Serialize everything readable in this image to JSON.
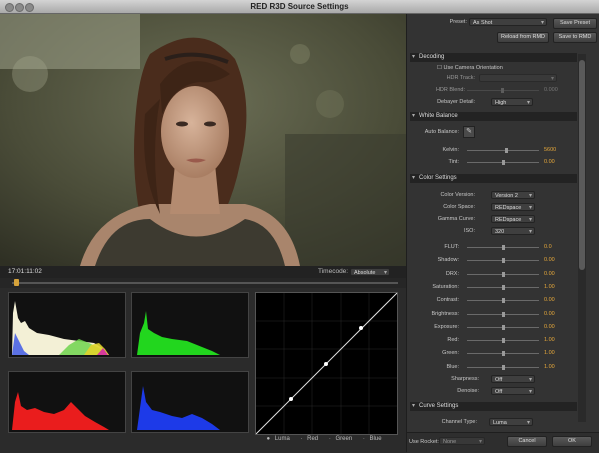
{
  "window": {
    "title": "RED R3D Source Settings"
  },
  "viewer": {
    "timecode": "17:01:11:02",
    "timecode_mode_label": "Timecode:",
    "timecode_mode_value": "Absolute"
  },
  "curve_legend": [
    "Luma",
    "Red",
    "Green",
    "Blue"
  ],
  "header": {
    "preset_label": "Preset:",
    "preset_value": "As Shot",
    "save_preset": "Save Preset",
    "reload": "Reload from RMD",
    "save_rmd": "Save to RMD"
  },
  "decoding": {
    "title": "Decoding",
    "use_camera_orientation": "Use Camera Orientation",
    "hdr_track": "HDR Track:",
    "hdr_blend": "HDR Blend:",
    "hdr_blend_value": "0.000",
    "debayer_label": "Debayer Detail:",
    "debayer_value": "High"
  },
  "white_balance": {
    "title": "White Balance",
    "auto_balance": "Auto Balance:",
    "kelvin_label": "Kelvin:",
    "kelvin_value": "5600",
    "kelvin_pos": 0.55,
    "tint_label": "Tint:",
    "tint_value": "0.00",
    "tint_pos": 0.5
  },
  "color_settings": {
    "title": "Color Settings",
    "color_version_label": "Color Version:",
    "color_version_value": "Version 2",
    "color_space_label": "Color Space:",
    "color_space_value": "REDspace",
    "gamma_label": "Gamma Curve:",
    "gamma_value": "REDspace",
    "iso_label": "ISO:",
    "iso_value": "320",
    "sliders": [
      {
        "label": "FLUT:",
        "value": "0.0",
        "pos": 0.5
      },
      {
        "label": "Shadow:",
        "value": "0.00",
        "pos": 0.5
      },
      {
        "label": "DRX:",
        "value": "0.00",
        "pos": 0.5
      },
      {
        "label": "Saturation:",
        "value": "1.00",
        "pos": 0.5
      },
      {
        "label": "Contrast:",
        "value": "0.00",
        "pos": 0.5
      },
      {
        "label": "Brightness:",
        "value": "0.00",
        "pos": 0.5
      },
      {
        "label": "Exposure:",
        "value": "0.00",
        "pos": 0.5
      },
      {
        "label": "Red:",
        "value": "1.00",
        "pos": 0.5
      },
      {
        "label": "Green:",
        "value": "1.00",
        "pos": 0.5
      },
      {
        "label": "Blue:",
        "value": "1.00",
        "pos": 0.5
      }
    ],
    "sharpness_label": "Sharpness:",
    "sharpness_value": "Off",
    "denoise_label": "Denoise:",
    "denoise_value": "Off"
  },
  "curve_settings": {
    "title": "Curve Settings",
    "channel_label": "Channel Type:",
    "channel_value": "Luma"
  },
  "footer": {
    "use_rocket": "Use Rocket:",
    "rocket_value": "None",
    "cancel": "Cancel",
    "ok": "OK"
  },
  "colors": {
    "accent_value": "#e6a83b",
    "panel_bg": "#333333",
    "section_bg": "#232323"
  }
}
